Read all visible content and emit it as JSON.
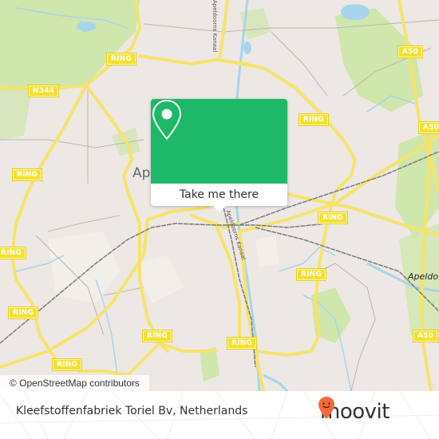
{
  "map": {
    "city_label": "Ap",
    "city_label_east": "Apeldo",
    "canal_labels": [
      "Apeldoorns Kanaal",
      "Apeldoorns Kanaal"
    ],
    "road_shields": [
      {
        "text": "RING",
        "id": "ring-nw"
      },
      {
        "text": "N344",
        "id": "n344"
      },
      {
        "text": "RING",
        "id": "ring-w-upper"
      },
      {
        "text": "A50",
        "id": "a50-n"
      },
      {
        "text": "RING",
        "id": "ring-ne"
      },
      {
        "text": "A50",
        "id": "a50-e"
      },
      {
        "text": "RING",
        "id": "ring-w-mid"
      },
      {
        "text": "RING",
        "id": "ring-e-mid"
      },
      {
        "text": "RING",
        "id": "ring-se-upper"
      },
      {
        "text": "RING",
        "id": "ring-sw-lower"
      },
      {
        "text": "RING",
        "id": "ring-s-center"
      },
      {
        "text": "RING",
        "id": "ring-s-lower"
      },
      {
        "text": "RING",
        "id": "ring-sw-bottom"
      },
      {
        "text": "RING",
        "id": "ring-s-right"
      },
      {
        "text": "A50",
        "id": "a50-se"
      }
    ],
    "colors": {
      "background": "#ede8e4",
      "road": "#f6e36b",
      "shield": "#f3e12e",
      "park": "#c8e3a4",
      "water": "#a8d4ec",
      "rail": "#777777"
    }
  },
  "attribution": "© OpenStreetMap contributors",
  "popup": {
    "button_label": "Take me there",
    "icon": "map-pin-icon",
    "color": "#1db868"
  },
  "footer": {
    "place_name": "Kleefstoffenfabriek Toriel Bv, Netherlands",
    "logo_text": "moovit",
    "logo_color": "#f26a3b"
  }
}
